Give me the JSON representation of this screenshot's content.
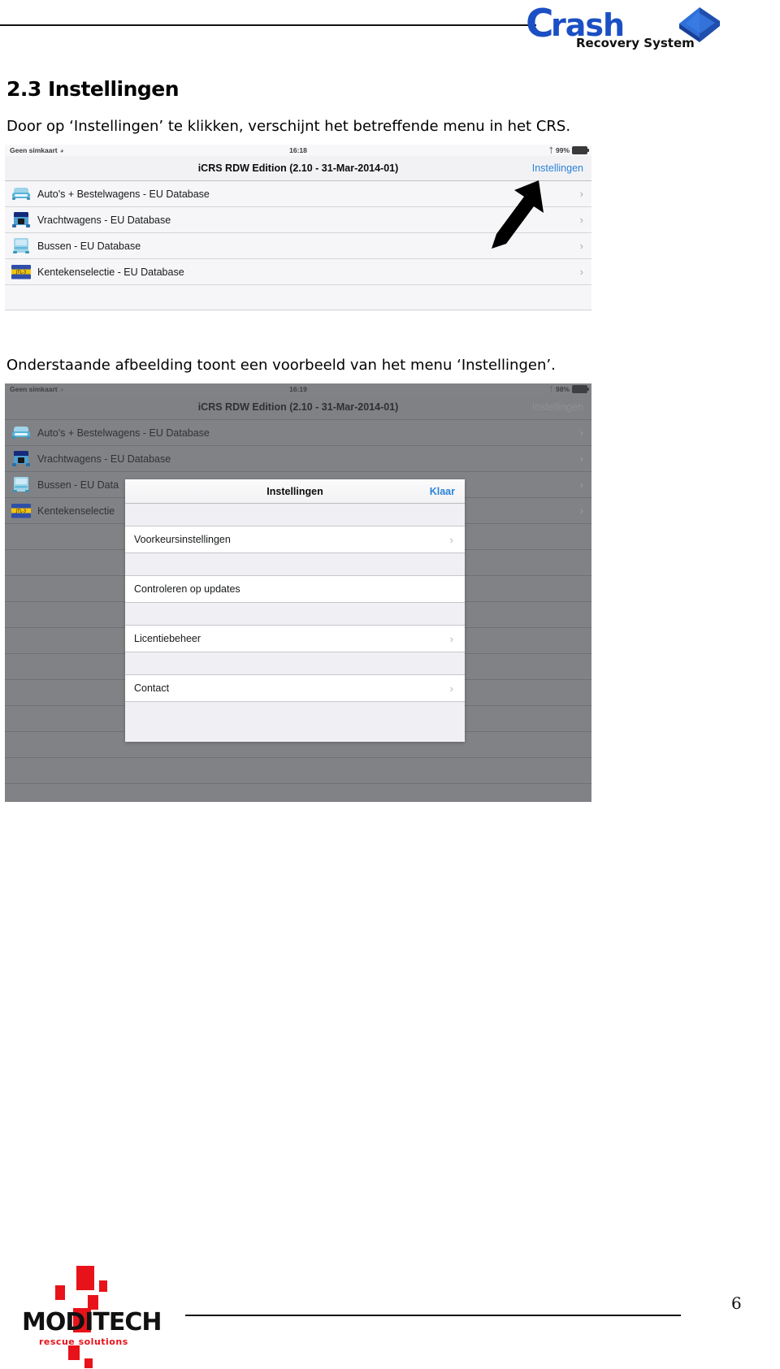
{
  "header": {
    "logo": {
      "initial": "C",
      "word": "rash",
      "tagline": "Recovery System",
      "cube_icon": "blue-cube-icon",
      "brand_color": "#1b4fc4"
    }
  },
  "document": {
    "heading": "2.3 Instellingen",
    "paragraph_1": "Door op ‘Instellingen’ te klikken, verschijnt het betreffende menu in het CRS.",
    "paragraph_2": "Onderstaande afbeelding toont een voorbeeld van het menu ‘Instellingen’."
  },
  "screenshot_1": {
    "status_bar": {
      "carrier": "Geen simkaart",
      "wifi_icon": "wifi-icon",
      "time": "16:18",
      "bluetooth_icon": "bluetooth-icon",
      "battery_percent": "99%",
      "battery_level": 99
    },
    "nav": {
      "title": "iCRS RDW Edition (2.10 - 31-Mar-2014-01)",
      "action": "Instellingen"
    },
    "rows": [
      {
        "icon": "car-icon",
        "label": "Auto's + Bestelwagens - EU Database",
        "chevron": "›"
      },
      {
        "icon": "truck-icon",
        "label": "Vrachtwagens - EU Database",
        "chevron": "›"
      },
      {
        "icon": "bus-icon",
        "label": "Bussen - EU Database",
        "chevron": "›"
      },
      {
        "icon": "licenseplate-icon",
        "label": "Kentekenselectie - EU Database",
        "chevron": "›"
      }
    ],
    "annotation": {
      "arrow_icon": "black-arrow-icon",
      "points_to": "Instellingen"
    }
  },
  "screenshot_2": {
    "status_bar": {
      "carrier": "Geen simkaart",
      "wifi_icon": "wifi-icon",
      "time": "16:19",
      "bluetooth_icon": "bluetooth-icon",
      "battery_percent": "98%",
      "battery_level": 98
    },
    "nav": {
      "title": "iCRS RDW Edition (2.10 - 31-Mar-2014-01)",
      "action": "Instellingen"
    },
    "rows": [
      {
        "icon": "car-icon",
        "label": "Auto's + Bestelwagens - EU Database",
        "chevron": "›"
      },
      {
        "icon": "truck-icon",
        "label": "Vrachtwagens - EU Database",
        "chevron": "›"
      },
      {
        "icon": "bus-icon",
        "label": "Bussen - EU Data",
        "chevron": "›"
      },
      {
        "icon": "licenseplate-icon",
        "label": "Kentekenselectie",
        "chevron": "›"
      }
    ],
    "popover": {
      "title": "Instellingen",
      "done_label": "Klaar",
      "accent_color": "#2b82d9",
      "items": [
        {
          "label": "Voorkeursinstellingen",
          "chevron": "›"
        },
        {
          "label": "Controleren op updates",
          "chevron": ""
        },
        {
          "label": "Licentiebeheer",
          "chevron": "›"
        },
        {
          "label": "Contact",
          "chevron": "›"
        }
      ]
    }
  },
  "footer": {
    "logo": {
      "word": "MODITECH",
      "tagline": "rescue solutions",
      "accent_color": "#e8131a"
    },
    "page_number": "6"
  }
}
